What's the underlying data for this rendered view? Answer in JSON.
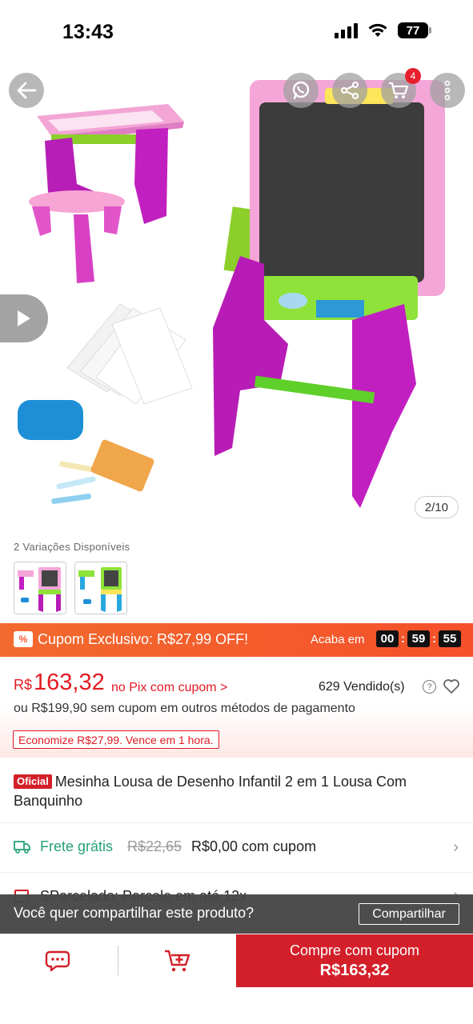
{
  "status_bar": {
    "time": "13:43",
    "battery": "77"
  },
  "gallery": {
    "counter": "2/10",
    "cart_count": "4"
  },
  "variations": {
    "title": "2 Variações Disponíveis"
  },
  "coupon": {
    "icon_text": "%",
    "text": "Cupom Exclusivo: R$27,99 OFF!",
    "ends_label": "Acaba em",
    "hours": "00",
    "minutes": "59",
    "seconds": "55"
  },
  "price": {
    "currency": "R$",
    "value": "163,32",
    "note": "no Pix com cupom >",
    "sold": "629 Vendido(s)",
    "help": "?",
    "alt": "ou R$199,90 sem cupom em outros métodos de pagamento",
    "savings": "Economize R$27,99. Vence em 1 hora."
  },
  "product": {
    "official_badge": "Oficial",
    "title": "Mesinha Lousa de Desenho Infantil 2 em 1 Lousa Com Banquinho"
  },
  "shipping": {
    "free_label": "Frete grátis",
    "old_price": "R$22,65",
    "new_price": "R$0,00 com cupom"
  },
  "installments": {
    "text": "SParcelado: Parcele em até 12x"
  },
  "share": {
    "question": "Você quer compartilhar este produto?",
    "button": "Compartilhar"
  },
  "bottom_bar": {
    "buy_label": "Compre com cupom",
    "buy_price": "R$163,32"
  },
  "colors": {
    "brand_red": "#d31f29",
    "coupon_orange": "#f2582c",
    "free_green": "#26a17b"
  }
}
